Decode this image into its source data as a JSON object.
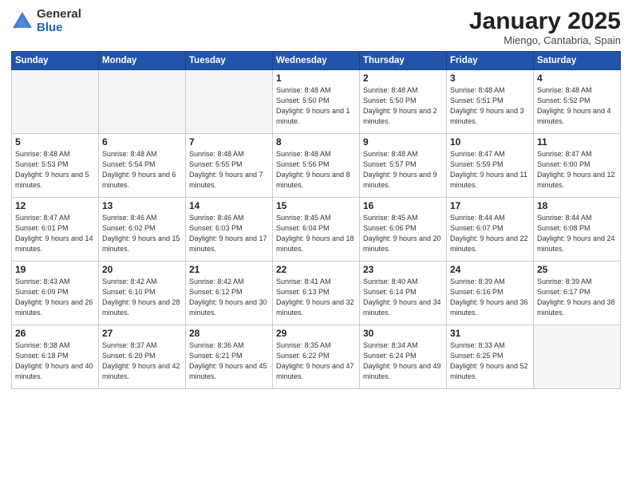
{
  "logo": {
    "general": "General",
    "blue": "Blue"
  },
  "calendar": {
    "title": "January 2025",
    "subtitle": "Miengo, Cantabria, Spain"
  },
  "weekdays": [
    "Sunday",
    "Monday",
    "Tuesday",
    "Wednesday",
    "Thursday",
    "Friday",
    "Saturday"
  ],
  "weeks": [
    [
      {
        "day": "",
        "info": ""
      },
      {
        "day": "",
        "info": ""
      },
      {
        "day": "",
        "info": ""
      },
      {
        "day": "1",
        "info": "Sunrise: 8:48 AM\nSunset: 5:50 PM\nDaylight: 9 hours and 1 minute."
      },
      {
        "day": "2",
        "info": "Sunrise: 8:48 AM\nSunset: 5:50 PM\nDaylight: 9 hours and 2 minutes."
      },
      {
        "day": "3",
        "info": "Sunrise: 8:48 AM\nSunset: 5:51 PM\nDaylight: 9 hours and 3 minutes."
      },
      {
        "day": "4",
        "info": "Sunrise: 8:48 AM\nSunset: 5:52 PM\nDaylight: 9 hours and 4 minutes."
      }
    ],
    [
      {
        "day": "5",
        "info": "Sunrise: 8:48 AM\nSunset: 5:53 PM\nDaylight: 9 hours and 5 minutes."
      },
      {
        "day": "6",
        "info": "Sunrise: 8:48 AM\nSunset: 5:54 PM\nDaylight: 9 hours and 6 minutes."
      },
      {
        "day": "7",
        "info": "Sunrise: 8:48 AM\nSunset: 5:55 PM\nDaylight: 9 hours and 7 minutes."
      },
      {
        "day": "8",
        "info": "Sunrise: 8:48 AM\nSunset: 5:56 PM\nDaylight: 9 hours and 8 minutes."
      },
      {
        "day": "9",
        "info": "Sunrise: 8:48 AM\nSunset: 5:57 PM\nDaylight: 9 hours and 9 minutes."
      },
      {
        "day": "10",
        "info": "Sunrise: 8:47 AM\nSunset: 5:59 PM\nDaylight: 9 hours and 11 minutes."
      },
      {
        "day": "11",
        "info": "Sunrise: 8:47 AM\nSunset: 6:00 PM\nDaylight: 9 hours and 12 minutes."
      }
    ],
    [
      {
        "day": "12",
        "info": "Sunrise: 8:47 AM\nSunset: 6:01 PM\nDaylight: 9 hours and 14 minutes."
      },
      {
        "day": "13",
        "info": "Sunrise: 8:46 AM\nSunset: 6:02 PM\nDaylight: 9 hours and 15 minutes."
      },
      {
        "day": "14",
        "info": "Sunrise: 8:46 AM\nSunset: 6:03 PM\nDaylight: 9 hours and 17 minutes."
      },
      {
        "day": "15",
        "info": "Sunrise: 8:45 AM\nSunset: 6:04 PM\nDaylight: 9 hours and 18 minutes."
      },
      {
        "day": "16",
        "info": "Sunrise: 8:45 AM\nSunset: 6:06 PM\nDaylight: 9 hours and 20 minutes."
      },
      {
        "day": "17",
        "info": "Sunrise: 8:44 AM\nSunset: 6:07 PM\nDaylight: 9 hours and 22 minutes."
      },
      {
        "day": "18",
        "info": "Sunrise: 8:44 AM\nSunset: 6:08 PM\nDaylight: 9 hours and 24 minutes."
      }
    ],
    [
      {
        "day": "19",
        "info": "Sunrise: 8:43 AM\nSunset: 6:09 PM\nDaylight: 9 hours and 26 minutes."
      },
      {
        "day": "20",
        "info": "Sunrise: 8:42 AM\nSunset: 6:10 PM\nDaylight: 9 hours and 28 minutes."
      },
      {
        "day": "21",
        "info": "Sunrise: 8:42 AM\nSunset: 6:12 PM\nDaylight: 9 hours and 30 minutes."
      },
      {
        "day": "22",
        "info": "Sunrise: 8:41 AM\nSunset: 6:13 PM\nDaylight: 9 hours and 32 minutes."
      },
      {
        "day": "23",
        "info": "Sunrise: 8:40 AM\nSunset: 6:14 PM\nDaylight: 9 hours and 34 minutes."
      },
      {
        "day": "24",
        "info": "Sunrise: 8:39 AM\nSunset: 6:16 PM\nDaylight: 9 hours and 36 minutes."
      },
      {
        "day": "25",
        "info": "Sunrise: 8:39 AM\nSunset: 6:17 PM\nDaylight: 9 hours and 38 minutes."
      }
    ],
    [
      {
        "day": "26",
        "info": "Sunrise: 8:38 AM\nSunset: 6:18 PM\nDaylight: 9 hours and 40 minutes."
      },
      {
        "day": "27",
        "info": "Sunrise: 8:37 AM\nSunset: 6:20 PM\nDaylight: 9 hours and 42 minutes."
      },
      {
        "day": "28",
        "info": "Sunrise: 8:36 AM\nSunset: 6:21 PM\nDaylight: 9 hours and 45 minutes."
      },
      {
        "day": "29",
        "info": "Sunrise: 8:35 AM\nSunset: 6:22 PM\nDaylight: 9 hours and 47 minutes."
      },
      {
        "day": "30",
        "info": "Sunrise: 8:34 AM\nSunset: 6:24 PM\nDaylight: 9 hours and 49 minutes."
      },
      {
        "day": "31",
        "info": "Sunrise: 8:33 AM\nSunset: 6:25 PM\nDaylight: 9 hours and 52 minutes."
      },
      {
        "day": "",
        "info": ""
      }
    ]
  ]
}
